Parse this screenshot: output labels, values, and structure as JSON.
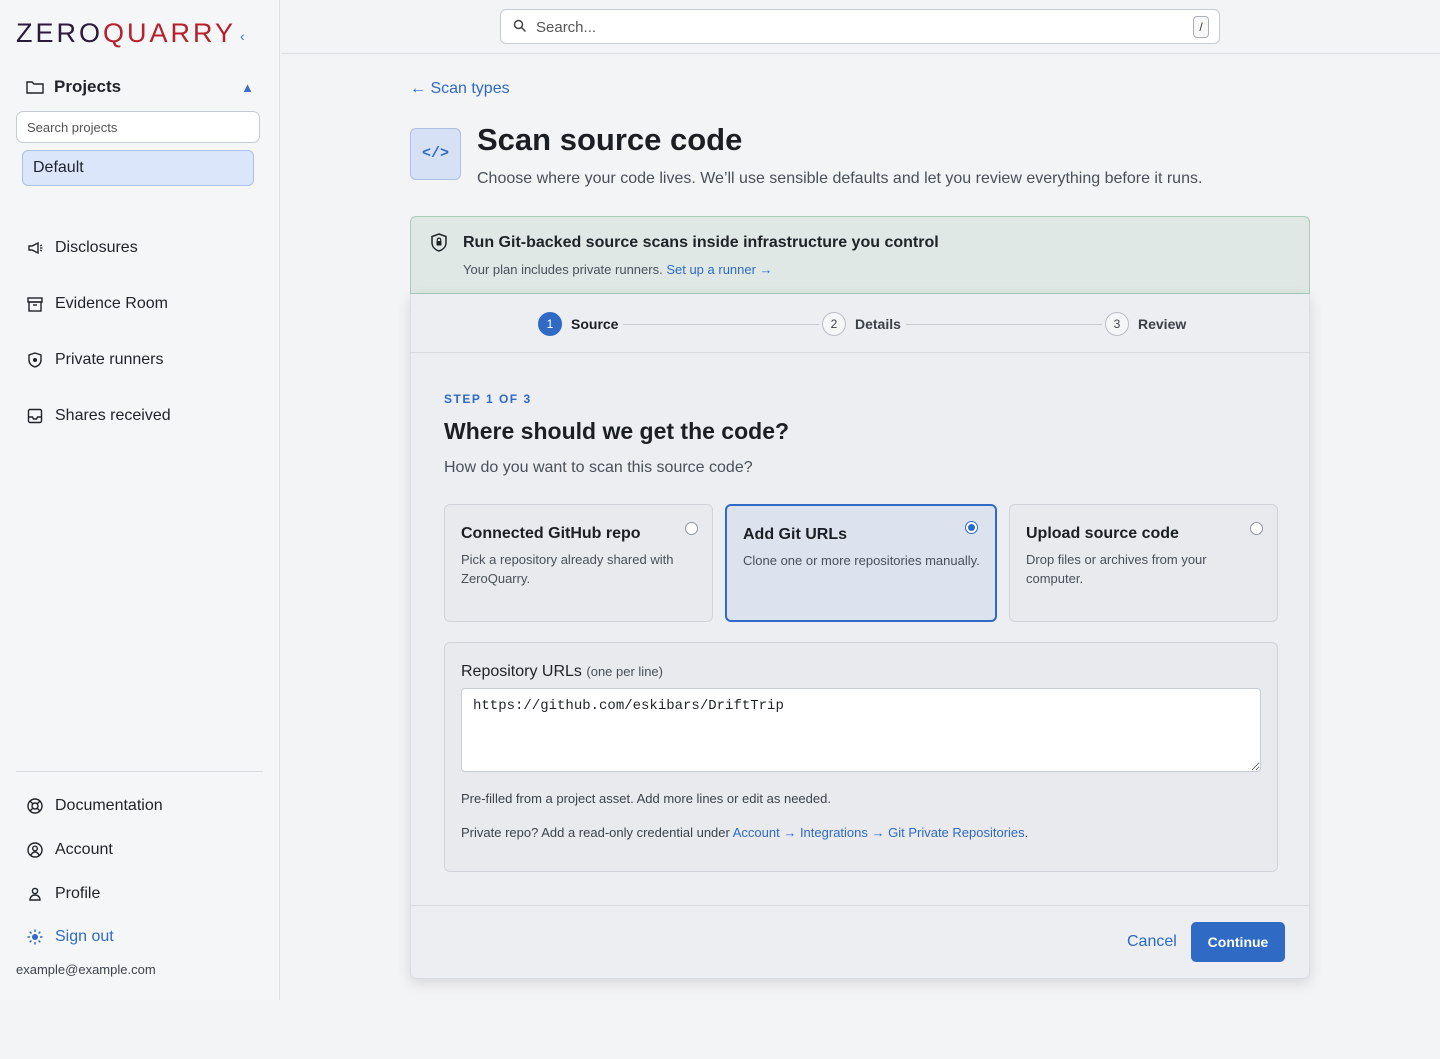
{
  "brand": {
    "name_part1": "ZERO",
    "name_part2": "QUARRY",
    "colors": {
      "dark": "#2a1a3c",
      "red": "#b5202c"
    }
  },
  "sidebar": {
    "collapse_icon": "chevron-left-icon",
    "projects": {
      "label": "Projects",
      "search_placeholder": "Search projects",
      "selected": "Default"
    },
    "nav": [
      {
        "label": "Disclosures",
        "icon": "megaphone-icon"
      },
      {
        "label": "Evidence Room",
        "icon": "archive-icon"
      },
      {
        "label": "Private runners",
        "icon": "shield-icon"
      },
      {
        "label": "Shares received",
        "icon": "inbox-icon"
      }
    ],
    "bottom": [
      {
        "label": "Documentation",
        "icon": "lifebuoy-icon"
      },
      {
        "label": "Account",
        "icon": "user-circle-icon"
      },
      {
        "label": "Profile",
        "icon": "user-icon"
      }
    ],
    "signout": "Sign out",
    "email": "example@example.com"
  },
  "topbar": {
    "search_placeholder": "Search...",
    "shortcut": "/"
  },
  "main": {
    "back_link": "← Scan types",
    "title_icon_text": "</>",
    "title": "Scan source code",
    "subtitle": "Choose where your code lives. We’ll use sensible defaults and let you review everything before it runs.",
    "banner": {
      "title": "Run Git-backed source scans inside infrastructure you control",
      "text": "Your plan includes private runners.",
      "link": "Set up a runner →"
    },
    "stepper": [
      {
        "num": "1",
        "label": "Source",
        "active": true
      },
      {
        "num": "2",
        "label": "Details",
        "active": false
      },
      {
        "num": "3",
        "label": "Review",
        "active": false
      }
    ],
    "step_label": "STEP 1 OF 3",
    "question": "Where should we get the code?",
    "question_sub": "How do you want to scan this source code?",
    "options": [
      {
        "title": "Connected GitHub repo",
        "desc": "Pick a repository already shared with ZeroQuarry.",
        "selected": false
      },
      {
        "title": "Add Git URLs",
        "desc": "Clone one or more repositories manually.",
        "selected": true
      },
      {
        "title": "Upload source code",
        "desc": "Drop files or archives from your computer.",
        "selected": false
      }
    ],
    "repo": {
      "label": "Repository URLs",
      "label_hint": "(one per line)",
      "value": "https://github.com/eskibars/DriftTrip",
      "hint1": "Pre-filled from a project asset. Add more lines or edit as needed.",
      "hint2_prefix": "Private repo? Add a read-only credential under",
      "hint2_link": "Account → Integrations → Git Private Repositories",
      "hint2_suffix": "."
    },
    "cancel": "Cancel",
    "continue": "Continue",
    "accent_color": "#2f6ac5"
  }
}
